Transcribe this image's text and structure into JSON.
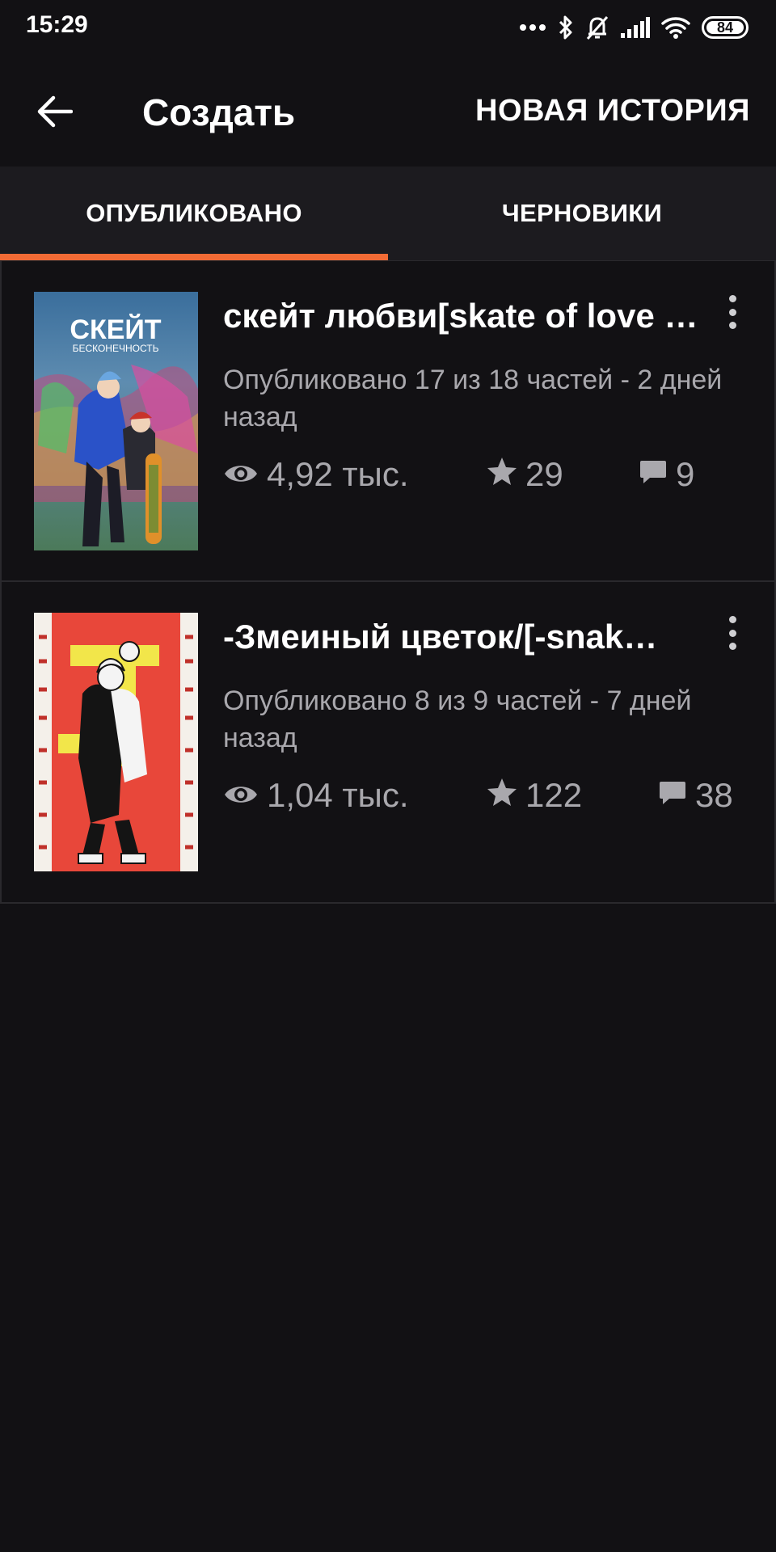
{
  "status_bar": {
    "time": "15:29",
    "battery": "84",
    "icons": [
      "more-dots-icon",
      "bluetooth-icon",
      "bell-off-icon",
      "signal-icon",
      "wifi-icon",
      "battery-icon"
    ]
  },
  "app_bar": {
    "title": "Создать",
    "action_label": "НОВАЯ ИСТОРИЯ"
  },
  "tabs": [
    {
      "label": "ОПУБЛИКОВАНО",
      "active": true
    },
    {
      "label": "ЧЕРНОВИКИ",
      "active": false
    }
  ],
  "colors": {
    "accent": "#f26b35",
    "background": "#121114",
    "tab_bar": "#1c1b1f",
    "secondary_text": "#a9a8ad"
  },
  "stories": [
    {
      "title": "скейт любви[skate of love …",
      "status": "Опубликовано 17 из 18 частей - 2 дней назад",
      "views": "4,92 тыс.",
      "votes": "29",
      "comments": "9",
      "cover": {
        "title": "СКЕЙТ",
        "subtitle": "БЕСКОНЕЧНОСТЬ"
      }
    },
    {
      "title": "-Змеиный цветок/[-snak…",
      "status": "Опубликовано 8 из 9 частей - 7 дней назад",
      "views": "1,04 тыс.",
      "votes": "122",
      "comments": "38"
    }
  ]
}
